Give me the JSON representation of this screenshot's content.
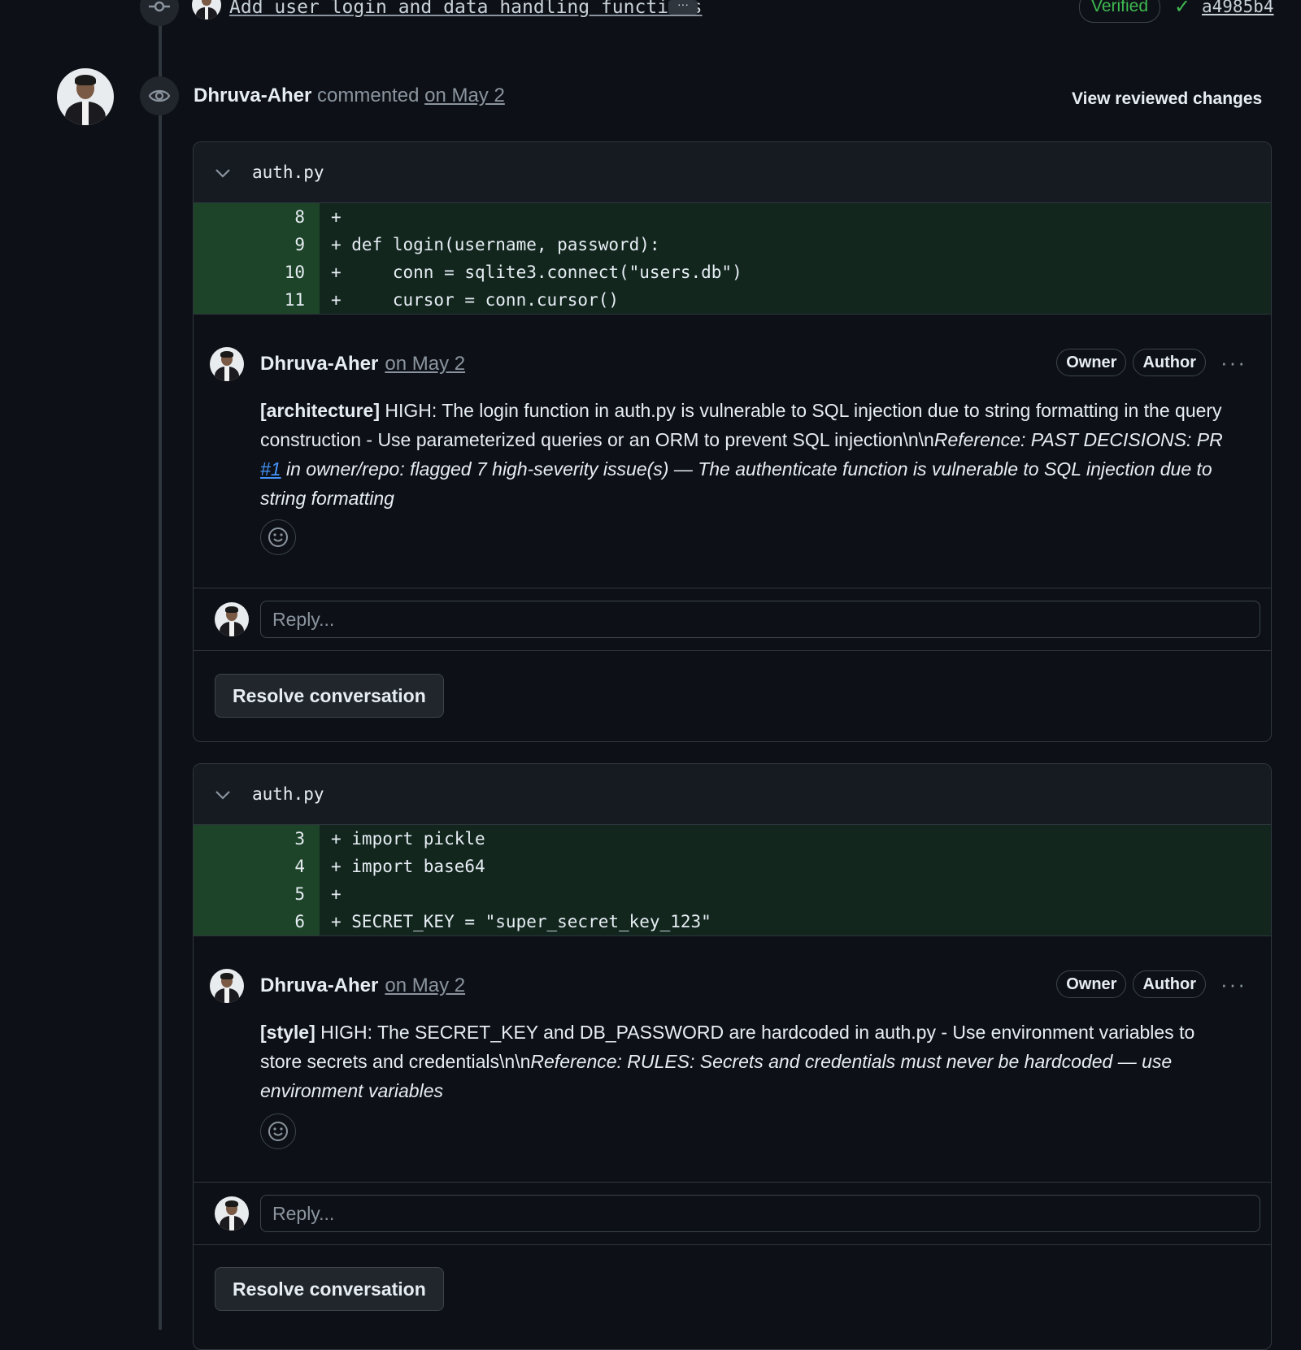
{
  "commit": {
    "message": "Add user login and data handling functions",
    "more_label": "···",
    "verified_label": "Verified",
    "sha": "a4985b4"
  },
  "review": {
    "user": "Dhruva-Aher",
    "action": "commented",
    "date": "on May 2",
    "view_reviewed_label": "View reviewed changes"
  },
  "threads": [
    {
      "filename": "auth.py",
      "diff": [
        {
          "line": "8",
          "code": "+"
        },
        {
          "line": "9",
          "code": "+ def login(username, password):"
        },
        {
          "line": "10",
          "code": "+     conn = sqlite3.connect(\"users.db\")"
        },
        {
          "line": "11",
          "code": "+     cursor = conn.cursor()"
        }
      ],
      "comment": {
        "user": "Dhruva-Aher",
        "date": "on May 2",
        "labels": [
          "Owner",
          "Author"
        ],
        "tag": "[architecture]",
        "text": " HIGH: The login function in auth.py is vulnerable to SQL injection due to string formatting in the query construction - Use parameterized queries or an ORM to prevent SQL injection\\n\\n",
        "ref_prefix": "Reference: PAST DECISIONS: PR ",
        "ref_link": "#1",
        "ref_suffix": " in owner/repo: flagged 7 high-severity issue(s) — The authenticate function is vulnerable to SQL injection due to string formatting"
      },
      "reply_placeholder": "Reply...",
      "resolve_label": "Resolve conversation"
    },
    {
      "filename": "auth.py",
      "diff": [
        {
          "line": "3",
          "code": "+ import pickle"
        },
        {
          "line": "4",
          "code": "+ import base64"
        },
        {
          "line": "5",
          "code": "+"
        },
        {
          "line": "6",
          "code": "+ SECRET_KEY = \"super_secret_key_123\""
        }
      ],
      "comment": {
        "user": "Dhruva-Aher",
        "date": "on May 2",
        "labels": [
          "Owner",
          "Author"
        ],
        "tag": "[style]",
        "text": " HIGH: The SECRET_KEY and DB_PASSWORD are hardcoded in auth.py - Use environment variables to store secrets and credentials\\n\\n",
        "ref_prefix": "Reference: RULES: Secrets and credentials must never be hardcoded — use environment variables",
        "ref_link": "",
        "ref_suffix": ""
      },
      "reply_placeholder": "Reply...",
      "resolve_label": "Resolve conversation"
    }
  ],
  "icons": {
    "commit": "git-commit-icon",
    "eye": "eye-icon",
    "chevron": "chevron-down-icon",
    "check": "check-icon",
    "smiley": "smiley-icon",
    "kebab": "kebab-horizontal-icon"
  },
  "colors": {
    "background": "#0d1117",
    "added_line": "#12261e",
    "added_gutter": "#1d4428",
    "verified_green": "#3fb950",
    "link_blue": "#4493f8"
  }
}
